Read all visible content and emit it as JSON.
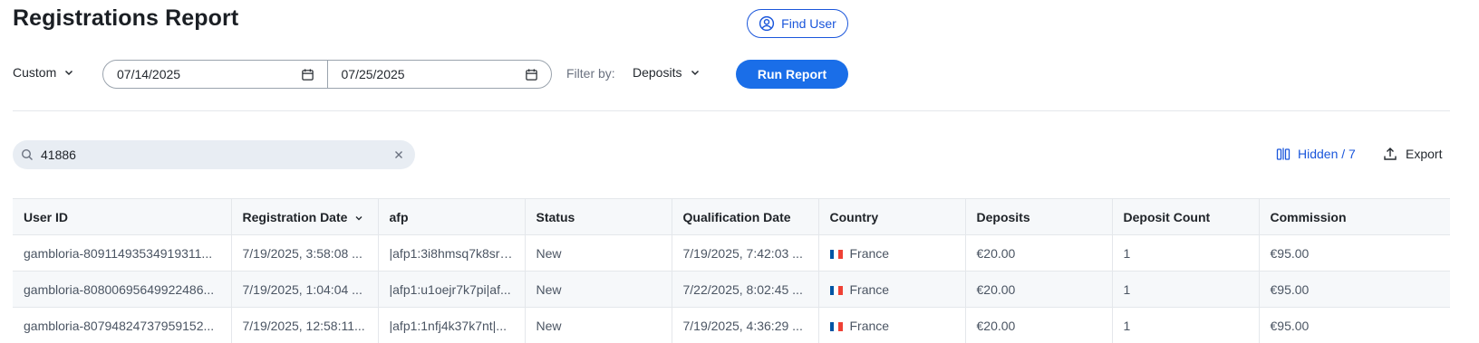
{
  "header": {
    "title": "Registrations Report",
    "find_user_label": "Find User"
  },
  "controls": {
    "preset": "Custom",
    "date_from": "07/14/2025",
    "date_to": "07/25/2025",
    "filter_label": "Filter by:",
    "filter_value": "Deposits",
    "run_label": "Run Report"
  },
  "toolbar": {
    "search_value": "41886",
    "hidden_label": "Hidden / 7",
    "export_label": "Export"
  },
  "colors": {
    "accent": "#1a6ee8",
    "link": "#1a56db",
    "flag_fr": [
      "#0055a4",
      "#ffffff",
      "#ef4135"
    ]
  },
  "table": {
    "columns": [
      "User ID",
      "Registration Date",
      "afp",
      "Status",
      "Qualification Date",
      "Country",
      "Deposits",
      "Deposit Count",
      "Commission"
    ],
    "rows": [
      {
        "user_id": "gambloria-80911493534919311...",
        "reg_date": "7/19/2025, 3:58:08 ...",
        "afp": "|afp1:3i8hmsq7k8sr|...",
        "status": "New",
        "qual_date": "7/19/2025, 7:42:03 ...",
        "country": "France",
        "deposits": "€20.00",
        "deposit_count": "1",
        "commission": "€95.00"
      },
      {
        "user_id": "gambloria-80800695649922486...",
        "reg_date": "7/19/2025, 1:04:04 ...",
        "afp": "|afp1:u1oejr7k7pi|af...",
        "status": "New",
        "qual_date": "7/22/2025, 8:02:45 ...",
        "country": "France",
        "deposits": "€20.00",
        "deposit_count": "1",
        "commission": "€95.00"
      },
      {
        "user_id": "gambloria-80794824737959152...",
        "reg_date": "7/19/2025, 12:58:11...",
        "afp": "|afp1:1nfj4k37k7nt|...",
        "status": "New",
        "qual_date": "7/19/2025, 4:36:29 ...",
        "country": "France",
        "deposits": "€20.00",
        "deposit_count": "1",
        "commission": "€95.00"
      }
    ]
  }
}
